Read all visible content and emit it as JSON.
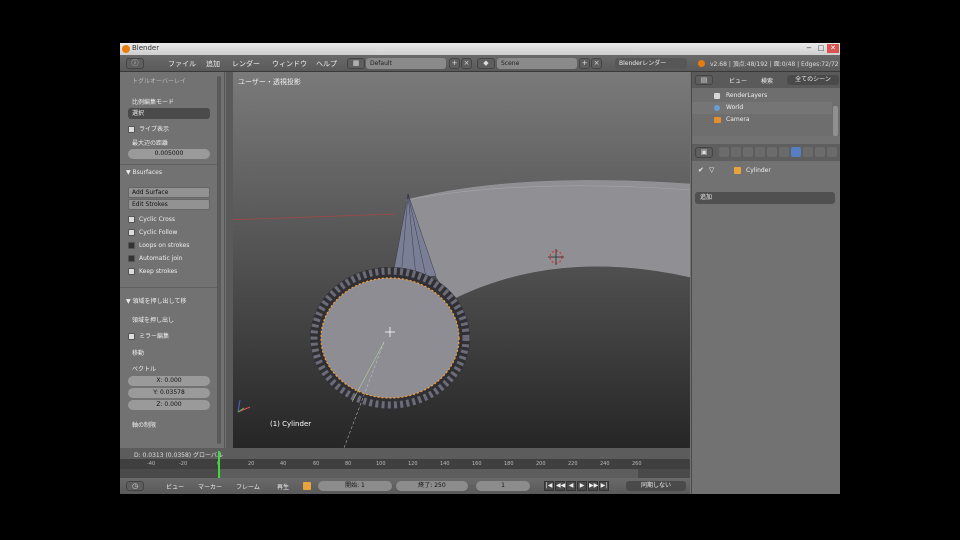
{
  "window": {
    "title": "Blender",
    "controls": [
      "−",
      "□",
      "✕"
    ]
  },
  "infobar": {
    "menus": [
      "ファイル",
      "追加",
      "レンダー",
      "ウィンドウ",
      "ヘルプ"
    ],
    "layout": "Default",
    "scene": "Scene",
    "engine": "Blenderレンダー",
    "stats": "v2.68 | 頂点:48/192 | 面:0/48 | Edges:72/72"
  },
  "toolshelf": {
    "header": "トグルオーバーレイ",
    "mode_label": "比例編集モード",
    "mode_value": "選択",
    "chk_1": "ライブ表示",
    "dist_label": "最大辺の距離",
    "dist_value": "0.005000",
    "bsurfaces_head": "▼ Bsurfaces",
    "btn_add_surface": "Add Surface",
    "btn_edit_strokes": "Edit Strokes",
    "chk_cyclic_cross": "Cyclic Cross",
    "chk_cyclic_follow": "Cyclic Follow",
    "chk_loops": "Loops on strokes",
    "chk_automatic": "Automatic join",
    "chk_keep": "Keep strokes",
    "extrude_head": "▼ 領域を押し出して移",
    "extrude_sub": "領域を押し出し",
    "chk_mirror": "ミラー編集",
    "move_label": "移動",
    "vector_label": "ベクトル",
    "vx": "X: 0.000",
    "vy": "Y: 0.03578",
    "vz": "Z: 0.000",
    "constraint": "軸の制限"
  },
  "viewport": {
    "title": "ユーザー・透視投影",
    "object": "(1) Cylinder",
    "status": "D: 0.0313 (0.0358) グローバル"
  },
  "timeline": {
    "ticks": [
      "-40",
      "-20",
      "0",
      "20",
      "40",
      "60",
      "80",
      "100",
      "120",
      "140",
      "160",
      "180",
      "200",
      "220",
      "240",
      "260"
    ],
    "menus": [
      "ビュー",
      "マーカー",
      "フレーム",
      "再生"
    ],
    "start": "開始: 1",
    "end": "終了: 250",
    "current": "1",
    "sync": "同期しない",
    "play_buttons": [
      "|◀",
      "◀◀",
      "◀",
      "▶",
      "▶▶",
      "▶|"
    ]
  },
  "outliner": {
    "menus": [
      "ビュー",
      "検索"
    ],
    "scope": "全てのシーン",
    "rows": [
      "RenderLayers",
      "World",
      "Camera"
    ]
  },
  "properties": {
    "object_name": "Cylinder",
    "dropdown": "追加"
  },
  "colors": {
    "accent": "#e87d0d",
    "selection": "#ffa030",
    "timeline_cursor": "#3ddc3d",
    "active_tab": "#5680c2"
  }
}
